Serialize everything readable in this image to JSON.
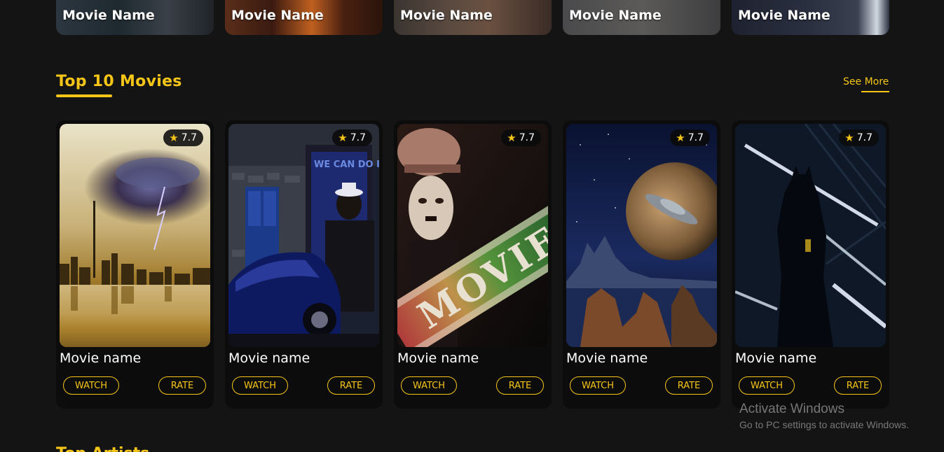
{
  "featured_row": {
    "items": [
      {
        "title": "Movie Name"
      },
      {
        "title": "Movie Name"
      },
      {
        "title": "Movie Name"
      },
      {
        "title": "Movie Name"
      },
      {
        "title": "Movie Name"
      }
    ]
  },
  "top_movies": {
    "heading": "Top 10 Movies",
    "see_more": "See More",
    "cards": [
      {
        "rating": "7.7",
        "name": "Movie name",
        "watch": "WATCH",
        "rate": "RATE"
      },
      {
        "rating": "7.7",
        "name": "Movie name",
        "watch": "WATCH",
        "rate": "RATE"
      },
      {
        "rating": "7.7",
        "name": "Movie name",
        "watch": "WATCH",
        "rate": "RATE"
      },
      {
        "rating": "7.7",
        "name": "Movie name",
        "watch": "WATCH",
        "rate": "RATE"
      },
      {
        "rating": "7.7",
        "name": "Movie name",
        "watch": "WATCH",
        "rate": "RATE"
      }
    ]
  },
  "next_section": {
    "heading": "Top Artists"
  },
  "watermark": {
    "line1": "Activate Windows",
    "line2": "Go to PC settings to activate Windows."
  },
  "colors": {
    "accent": "#f5c518",
    "background": "#141414",
    "card": "#0c0c0c"
  }
}
